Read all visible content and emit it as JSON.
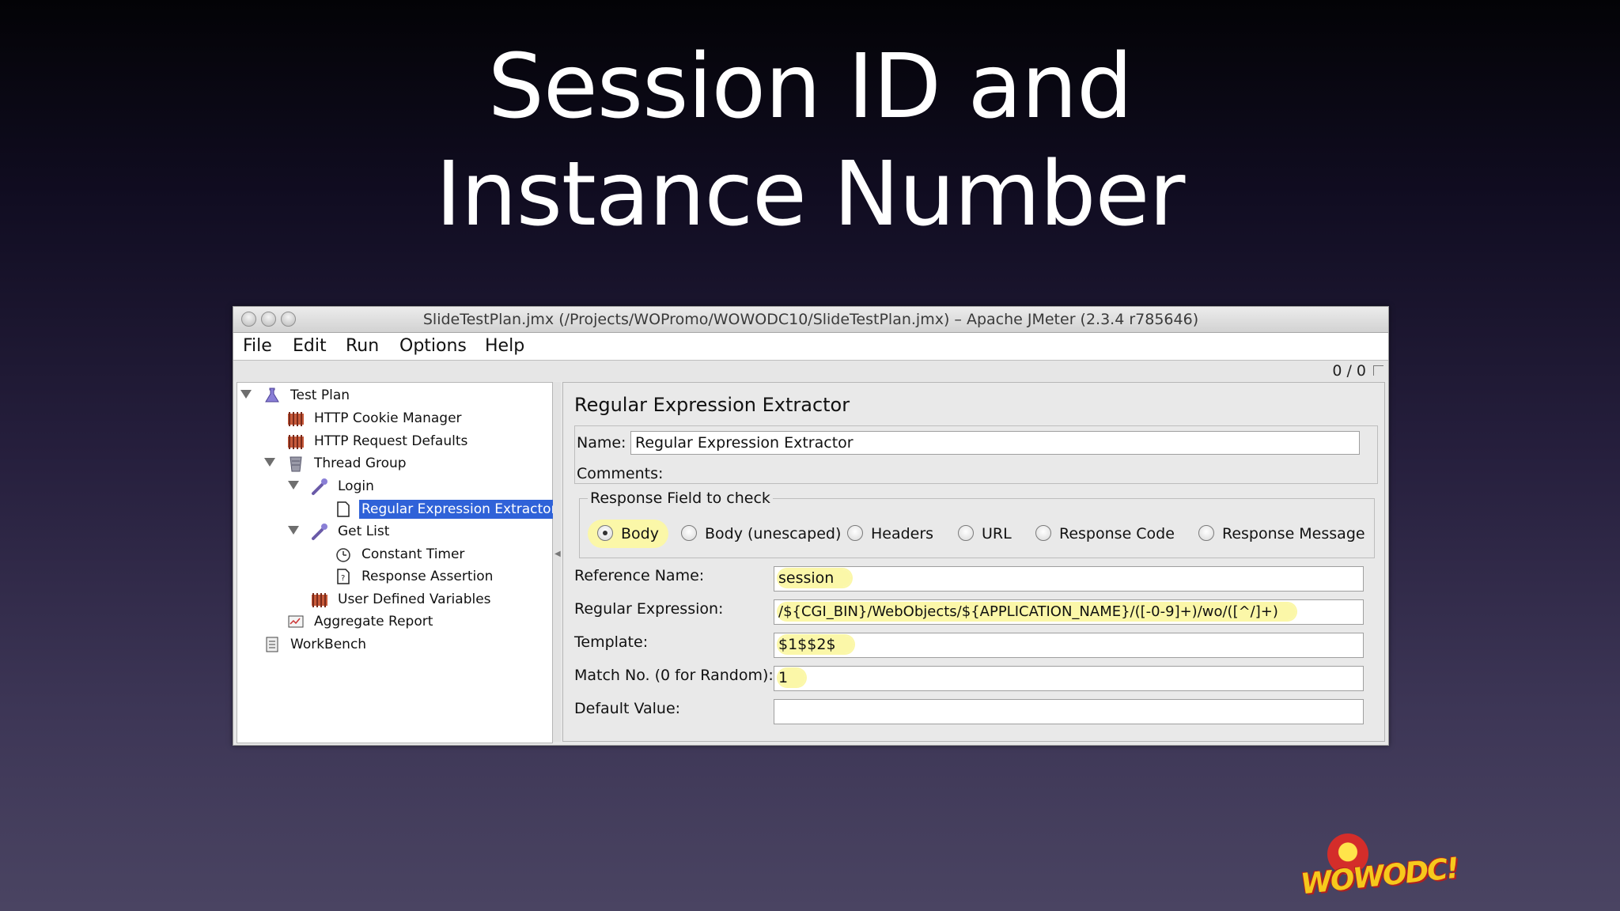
{
  "slide": {
    "title_line1": "Session ID and",
    "title_line2": "Instance Number"
  },
  "window": {
    "title": "SlideTestPlan.jmx (/Projects/WOPromo/WOWODC10/SlideTestPlan.jmx) – Apache JMeter (2.3.4 r785646)",
    "counter": "0 / 0"
  },
  "menu": {
    "items": [
      "File",
      "Edit",
      "Run",
      "Options",
      "Help"
    ]
  },
  "tree": {
    "nodes": [
      {
        "label": "Test Plan",
        "icon": "flask-icon",
        "expanded": true
      },
      {
        "label": "HTTP Cookie Manager",
        "icon": "config-element-icon"
      },
      {
        "label": "HTTP Request Defaults",
        "icon": "config-element-icon"
      },
      {
        "label": "Thread Group",
        "icon": "thread-group-icon",
        "expanded": true
      },
      {
        "label": "Login",
        "icon": "sampler-pipette-icon",
        "expanded": true
      },
      {
        "label": "Regular Expression Extractor",
        "icon": "document-icon",
        "selected": true
      },
      {
        "label": "Get List",
        "icon": "sampler-pipette-icon",
        "expanded": true
      },
      {
        "label": "Constant Timer",
        "icon": "timer-icon"
      },
      {
        "label": "Response Assertion",
        "icon": "assertion-icon"
      },
      {
        "label": "User Defined Variables",
        "icon": "config-element-icon"
      },
      {
        "label": "Aggregate Report",
        "icon": "report-icon"
      },
      {
        "label": "WorkBench",
        "icon": "workbench-icon"
      }
    ]
  },
  "editor": {
    "title": "Regular Expression Extractor",
    "name_label": "Name:",
    "name_value": "Regular Expression Extractor",
    "comments_label": "Comments:",
    "response_field_legend": "Response Field to check",
    "radio_options": [
      "Body",
      "Body (unescaped)",
      "Headers",
      "URL",
      "Response Code",
      "Response Message"
    ],
    "radio_selected": "Body",
    "reference_name_label": "Reference Name:",
    "reference_name_value": "session",
    "regex_label": "Regular Expression:",
    "regex_value": "/${CGI_BIN}/WebObjects/${APPLICATION_NAME}/([-0-9]+)/wo/([^/]+)",
    "template_label": "Template:",
    "template_value": "$1$$2$",
    "match_no_label": "Match No. (0 for Random):",
    "match_no_value": "1",
    "default_value_label": "Default Value:",
    "default_value_value": ""
  },
  "logo": {
    "text": "WOWODC!"
  },
  "colors": {
    "selection": "#2f62d8",
    "highlight": "#fbf7a8"
  }
}
